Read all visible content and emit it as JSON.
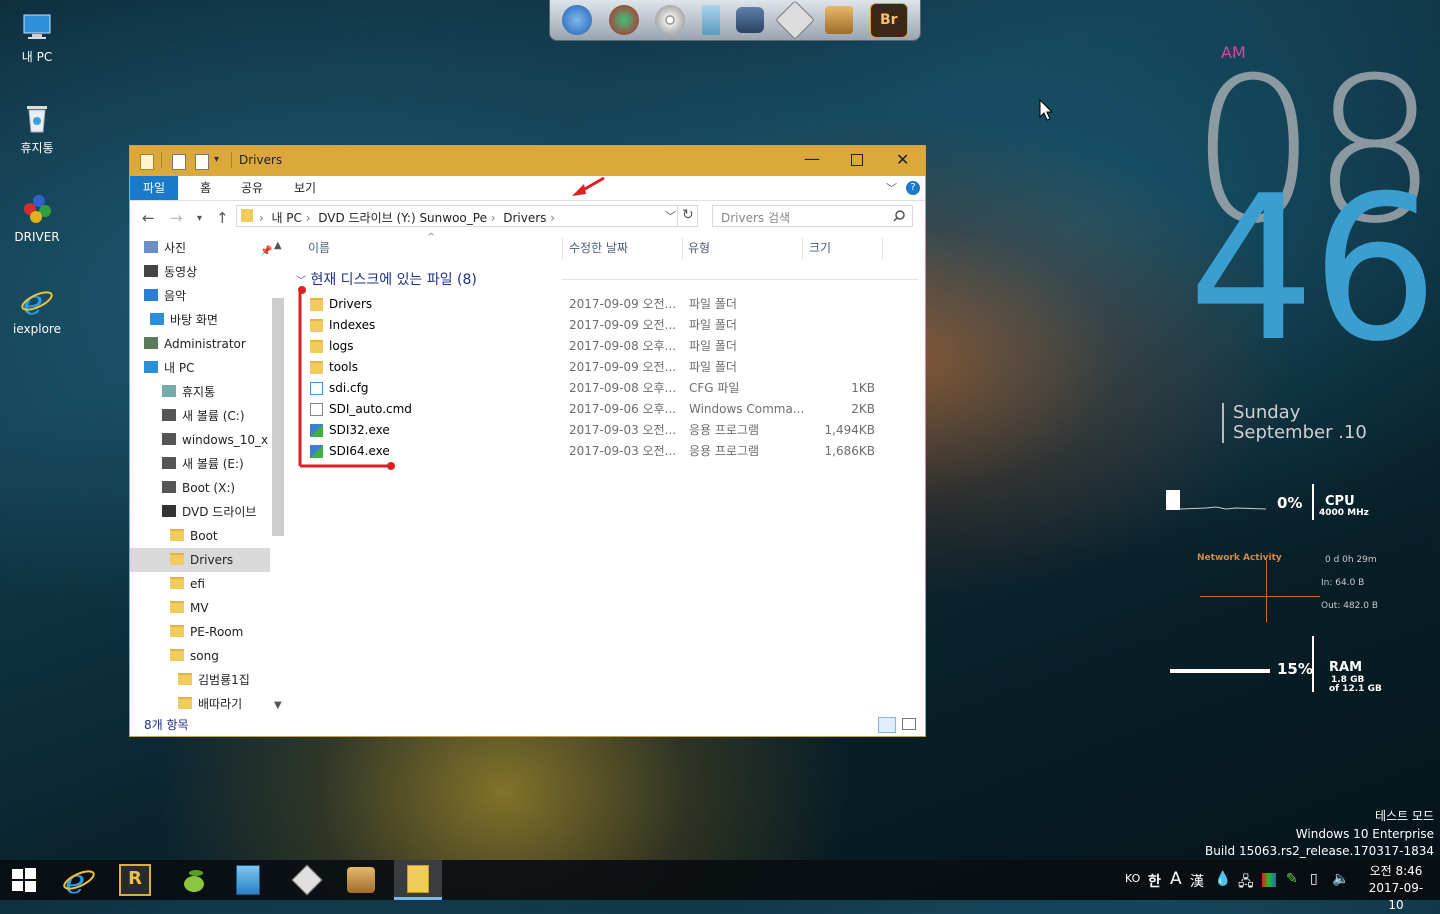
{
  "desktop": {
    "icons": [
      {
        "label": "내 PC",
        "icon": "computer-icon"
      },
      {
        "label": "휴지통",
        "icon": "recycle-bin-icon"
      },
      {
        "label": "DRIVER",
        "icon": "driver-icon"
      },
      {
        "label": "iexplore",
        "icon": "ie-icon"
      }
    ],
    "watermark": {
      "line1": "테스트 모드",
      "line2": "Windows 10 Enterprise",
      "line3": "Build 15063.rs2_release.170317-1834"
    }
  },
  "dock": {
    "items": [
      "app-1-icon",
      "app-2-icon",
      "disc-icon",
      "drive-icon",
      "monitor-icon",
      "card-icon",
      "installer-icon",
      "bridge-icon"
    ],
    "bridge_label": "Br"
  },
  "clock_widget": {
    "ampm": "AM",
    "hours": "08",
    "minutes": "46",
    "weekday": "Sunday",
    "date": "September .10",
    "cpu": {
      "percent": "0%",
      "label": "CPU",
      "freq": "4000 MHz"
    },
    "network": {
      "title": "Network Activity",
      "uptime": "0 d 0h 29m",
      "in": "In: 64.0 B",
      "out": "Out: 482.0 B"
    },
    "ram": {
      "percent": "15%",
      "label": "RAM",
      "used": "1.8 GB",
      "total": "of 12.1 GB",
      "level": 0.15
    }
  },
  "window": {
    "title": "Drivers",
    "ribbon_tabs": [
      "파일",
      "홈",
      "공유",
      "보기"
    ],
    "breadcrumb": [
      "내 PC",
      "DVD 드라이브 (Y:) Sunwoo_Pe",
      "Drivers"
    ],
    "search_placeholder": "Drivers 검색",
    "nav": [
      {
        "label": "사진",
        "indent": 1,
        "icon": "pictures-icon"
      },
      {
        "label": "동영상",
        "indent": 1,
        "icon": "videos-icon"
      },
      {
        "label": "음악",
        "indent": 1,
        "icon": "music-icon"
      },
      {
        "label": "바탕 화면",
        "indent": 0,
        "icon": "desktop-icon"
      },
      {
        "label": "Administrator",
        "indent": 1,
        "icon": "user-icon"
      },
      {
        "label": "내 PC",
        "indent": 1,
        "icon": "computer-icon"
      },
      {
        "label": "휴지통",
        "indent": 2,
        "icon": "recycle-bin-icon"
      },
      {
        "label": "새 볼륨 (C:)",
        "indent": 2,
        "icon": "drive-icon"
      },
      {
        "label": "windows_10_x",
        "indent": 2,
        "icon": "drive-icon"
      },
      {
        "label": "새 볼륨 (E:)",
        "indent": 2,
        "icon": "drive-icon"
      },
      {
        "label": "Boot (X:)",
        "indent": 2,
        "icon": "drive-icon"
      },
      {
        "label": "DVD 드라이브",
        "indent": 2,
        "icon": "dvd-icon"
      },
      {
        "label": "Boot",
        "indent": 3,
        "icon": "folder-icon"
      },
      {
        "label": "Drivers",
        "indent": 3,
        "icon": "folder-icon",
        "selected": true
      },
      {
        "label": "efi",
        "indent": 3,
        "icon": "folder-icon"
      },
      {
        "label": "MV",
        "indent": 3,
        "icon": "folder-icon"
      },
      {
        "label": "PE-Room",
        "indent": 3,
        "icon": "folder-icon"
      },
      {
        "label": "song",
        "indent": 3,
        "icon": "folder-icon"
      },
      {
        "label": "김범룡1집",
        "indent": 4,
        "icon": "folder-icon"
      },
      {
        "label": "배따라기",
        "indent": 4,
        "icon": "folder-icon"
      }
    ],
    "columns": [
      "이름",
      "수정한 날짜",
      "유형",
      "크기"
    ],
    "group_header": "현재 디스크에 있는 파일 (8)",
    "files": [
      {
        "name": "Drivers",
        "date": "2017-09-09 오전...",
        "type": "파일 폴더",
        "size": "",
        "icon": "folder-icon"
      },
      {
        "name": "Indexes",
        "date": "2017-09-09 오전...",
        "type": "파일 폴더",
        "size": "",
        "icon": "folder-icon"
      },
      {
        "name": "logs",
        "date": "2017-09-08 오후...",
        "type": "파일 폴더",
        "size": "",
        "icon": "folder-icon"
      },
      {
        "name": "tools",
        "date": "2017-09-09 오전...",
        "type": "파일 폴더",
        "size": "",
        "icon": "folder-icon"
      },
      {
        "name": "sdi.cfg",
        "date": "2017-09-08 오후...",
        "type": "CFG 파일",
        "size": "1KB",
        "icon": "cfg-file-icon"
      },
      {
        "name": "SDI_auto.cmd",
        "date": "2017-09-06 오후...",
        "type": "Windows Comma...",
        "size": "2KB",
        "icon": "cmd-file-icon"
      },
      {
        "name": "SDI32.exe",
        "date": "2017-09-03 오전...",
        "type": "응용 프로그램",
        "size": "1,494KB",
        "icon": "exe-file-icon"
      },
      {
        "name": "SDI64.exe",
        "date": "2017-09-03 오전...",
        "type": "응용 프로그램",
        "size": "1,686KB",
        "icon": "exe-file-icon"
      }
    ],
    "status": "8개 항목"
  },
  "taskbar": {
    "pinned": [
      "start-icon",
      "ie-icon",
      "r-app-icon",
      "leaf-app-icon",
      "notepad-icon",
      "card-icon",
      "installer-icon",
      "explorer-icon"
    ],
    "r_label": "R",
    "tray": {
      "lang": "KO",
      "ime": "한",
      "font": "A",
      "hanja": "漢",
      "time": "오전 8:46",
      "date": "2017-09-10"
    }
  },
  "colors": {
    "accent": "#1979ca",
    "titlebar": "#daa93a",
    "annotation": "#e02020",
    "clock_minutes": "#3a9ed0"
  }
}
